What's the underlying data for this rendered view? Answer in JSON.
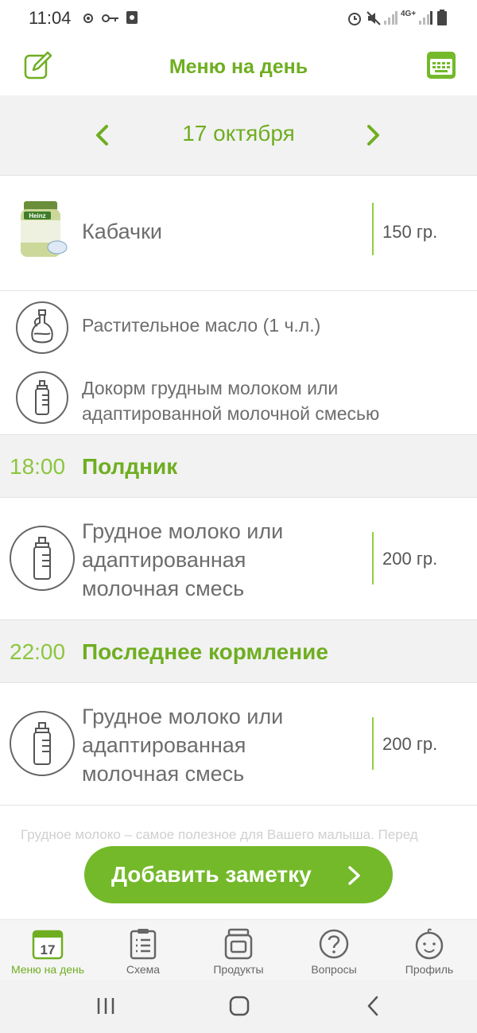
{
  "status_bar": {
    "time": "11:04",
    "network": "4G+"
  },
  "header": {
    "title": "Меню на день"
  },
  "date_nav": {
    "date": "17 октября"
  },
  "meal_item": {
    "name": "Кабачки",
    "weight": "150 гр.",
    "brand": "Heinz"
  },
  "additions": [
    {
      "text": "Растительное масло (1 ч.л.)",
      "icon": "oil-bottle-icon"
    },
    {
      "text_line1": "Докорм грудным молоком или",
      "text_line2": "адаптированной молочной смесью",
      "icon": "baby-bottle-icon"
    }
  ],
  "sections": [
    {
      "time": "18:00",
      "title": "Полдник",
      "item": {
        "line1": "Грудное молоко или",
        "line2": "адаптированная",
        "line3": "молочная смесь",
        "weight": "200 гр."
      }
    },
    {
      "time": "22:00",
      "title": "Последнее кормление",
      "item": {
        "line1": "Грудное молоко или",
        "line2": "адаптированная",
        "line3": "молочная смесь",
        "weight": "200 гр."
      }
    }
  ],
  "note_text": "Грудное молоко – самое полезное для Вашего малыша. Перед",
  "add_note_button": {
    "label": "Добавить заметку"
  },
  "tabs": [
    {
      "label": "Меню на день",
      "icon": "calendar-icon",
      "badge": "17",
      "active": true
    },
    {
      "label": "Схема",
      "icon": "clipboard-icon",
      "active": false
    },
    {
      "label": "Продукты",
      "icon": "jar-icon",
      "active": false
    },
    {
      "label": "Вопросы",
      "icon": "question-icon",
      "active": false
    },
    {
      "label": "Профиль",
      "icon": "baby-face-icon",
      "active": false
    }
  ],
  "colors": {
    "accent": "#6fae21",
    "accent_light": "#8cc63f",
    "button": "#73b92a",
    "section_bg": "#f2f2f2"
  }
}
